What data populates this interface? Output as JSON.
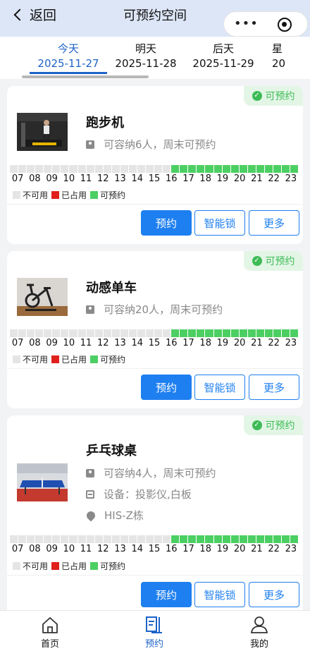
{
  "header": {
    "back_label": "返回",
    "title": "可预约空间"
  },
  "dates": [
    {
      "day": "今天",
      "date": "2025-11-27",
      "active": true
    },
    {
      "day": "明天",
      "date": "2025-11-28",
      "active": false
    },
    {
      "day": "后天",
      "date": "2025-11-29",
      "active": false
    },
    {
      "day": "星",
      "date": "20",
      "active": false
    }
  ],
  "hours": [
    "07",
    "08",
    "09",
    "10",
    "11",
    "12",
    "13",
    "14",
    "15",
    "16",
    "17",
    "18",
    "19",
    "20",
    "21",
    "22",
    "23"
  ],
  "legend": {
    "unavailable": "不可用",
    "occupied": "已占用",
    "available": "可预约"
  },
  "colors": {
    "unavailable": "#e5e5e5",
    "occupied": "#e0201c",
    "available": "#4ccf62",
    "accent": "#1e7ff0"
  },
  "rooms": [
    {
      "badge": "可预约",
      "name": "跑步机",
      "capacity": "可容纳6人，周末可预约",
      "equipment": "",
      "location": "",
      "image": "treadmill-photo",
      "slots": [
        "u",
        "u",
        "u",
        "u",
        "u",
        "u",
        "u",
        "u",
        "u",
        "u",
        "u",
        "u",
        "u",
        "u",
        "u",
        "u",
        "u",
        "u",
        "u",
        "a",
        "a",
        "a",
        "a",
        "a",
        "a",
        "a",
        "a",
        "a",
        "a",
        "a",
        "a",
        "a",
        "a",
        "a"
      ],
      "buttons": {
        "book": "预约",
        "lock": "智能锁",
        "more": "更多"
      }
    },
    {
      "badge": "可预约",
      "name": "动感单车",
      "capacity": "可容纳20人，周末可预约",
      "equipment": "",
      "location": "",
      "image": "spin-bike-photo",
      "slots": [
        "u",
        "u",
        "u",
        "u",
        "u",
        "u",
        "u",
        "u",
        "u",
        "u",
        "u",
        "u",
        "u",
        "u",
        "u",
        "u",
        "u",
        "u",
        "u",
        "a",
        "a",
        "a",
        "a",
        "a",
        "a",
        "a",
        "a",
        "a",
        "a",
        "a",
        "a",
        "a",
        "a",
        "a"
      ],
      "buttons": {
        "book": "预约",
        "lock": "智能锁",
        "more": "更多"
      }
    },
    {
      "badge": "可预约",
      "name": "乒乓球桌",
      "capacity": "可容纳4人，周末可预约",
      "equipment": "设备：投影仪,白板",
      "location": "HIS-Z栋",
      "image": "ping-pong-table-photo",
      "slots": [
        "u",
        "u",
        "u",
        "u",
        "u",
        "u",
        "u",
        "u",
        "u",
        "u",
        "u",
        "u",
        "u",
        "u",
        "u",
        "u",
        "u",
        "u",
        "u",
        "a",
        "a",
        "a",
        "a",
        "a",
        "a",
        "a",
        "a",
        "a",
        "a",
        "a",
        "a",
        "a",
        "a",
        "a"
      ],
      "buttons": {
        "book": "预约",
        "lock": "智能锁",
        "more": "更多"
      }
    }
  ],
  "tabbar": [
    {
      "label": "首页",
      "icon": "home-icon",
      "active": false
    },
    {
      "label": "预约",
      "icon": "booking-icon",
      "active": true
    },
    {
      "label": "我的",
      "icon": "profile-icon",
      "active": false
    }
  ]
}
